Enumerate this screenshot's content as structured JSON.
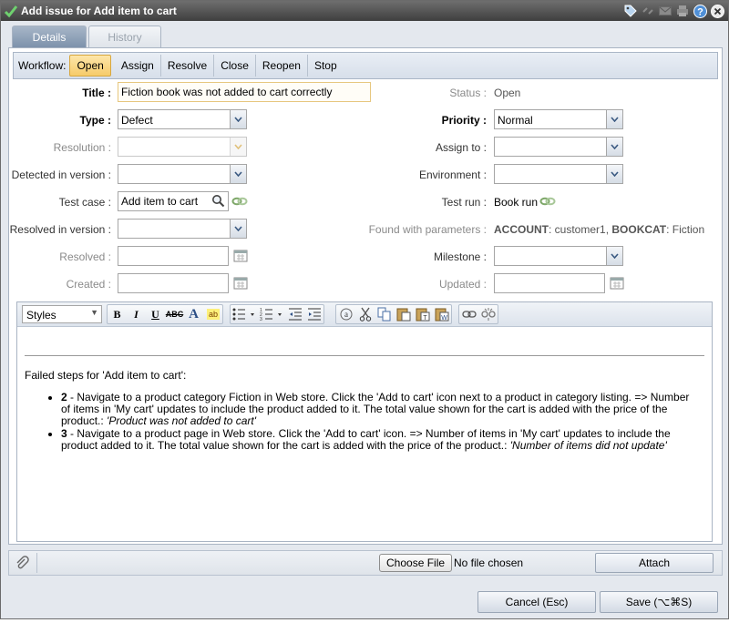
{
  "window": {
    "title": "Add issue for Add item to cart",
    "icons": [
      "tag-icon",
      "unlink-icon",
      "mail-icon",
      "print-icon",
      "help-icon",
      "close-icon"
    ]
  },
  "tabs": [
    {
      "label": "Details",
      "active": true
    },
    {
      "label": "History",
      "active": false
    }
  ],
  "workflow": {
    "label": "Workflow:",
    "actions": [
      "Open",
      "Assign",
      "Resolve",
      "Close",
      "Reopen",
      "Stop"
    ],
    "active": "Open"
  },
  "form": {
    "title_label": "Title :",
    "title_value": "Fiction book was not added to cart correctly",
    "status_label": "Status :",
    "status_value": "Open",
    "type_label": "Type :",
    "type_value": "Defect",
    "priority_label": "Priority :",
    "priority_value": "Normal",
    "resolution_label": "Resolution :",
    "resolution_value": "",
    "assign_to_label": "Assign to :",
    "assign_to_value": "",
    "detected_label": "Detected in version :",
    "detected_value": "",
    "environment_label": "Environment :",
    "environment_value": "",
    "test_case_label": "Test case :",
    "test_case_value": "Add item to cart",
    "test_run_label": "Test run :",
    "test_run_value": "Book run",
    "resolved_in_label": "Resolved in version :",
    "resolved_in_value": "",
    "found_params_label": "Found with parameters :",
    "found_params": [
      {
        "name": "ACCOUNT",
        "value": ": customer1, "
      },
      {
        "name": "BOOKCAT",
        "value": ": Fiction"
      }
    ],
    "resolved_label": "Resolved :",
    "resolved_value": "",
    "milestone_label": "Milestone :",
    "milestone_value": "",
    "created_label": "Created :",
    "created_value": "",
    "updated_label": "Updated :",
    "updated_value": ""
  },
  "editor": {
    "styles_label": "Styles",
    "intro": "Failed steps for 'Add item to cart':",
    "steps": [
      {
        "number": "2",
        "text": " - Navigate to a product category Fiction in Web store. Click the 'Add to cart' icon next to a product in category listing. => Number of items in 'My cart' updates to include the product added to it. The total value shown for the cart is added with the price of the product.: ",
        "result": "'Product was not added to cart'"
      },
      {
        "number": "3",
        "text": " - Navigate to a product page in Web store. Click the 'Add to cart' icon. => Number of items in 'My cart' updates to include the product added to it. The total value shown for the cart is added with the price of the product.: ",
        "result": "'Number of items did not update'"
      }
    ]
  },
  "attachments": {
    "choose_file_label": "Choose File",
    "no_file_label": "No file chosen",
    "attach_label": "Attach"
  },
  "footer": {
    "cancel_label": "Cancel (Esc)",
    "save_label": "Save (⌥⌘S)"
  }
}
